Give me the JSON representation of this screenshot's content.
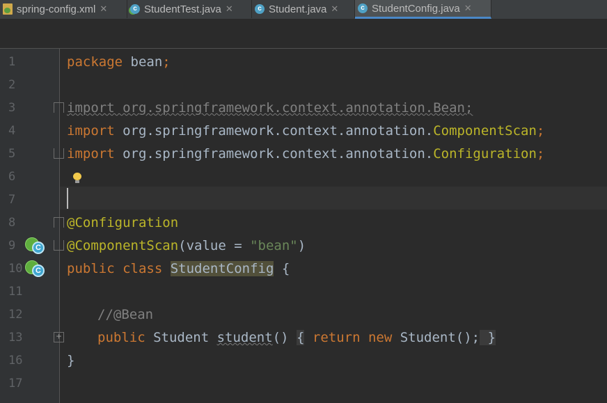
{
  "tabs": [
    {
      "label": "spring-config.xml",
      "icon": "spring-xml-file-icon",
      "active": false
    },
    {
      "label": "StudentTest.java",
      "icon": "runnable-class-icon",
      "active": false
    },
    {
      "label": "Student.java",
      "icon": "class-icon",
      "active": false
    },
    {
      "label": "StudentConfig.java",
      "icon": "class-icon",
      "active": true
    }
  ],
  "close_glyph": "✕",
  "line_numbers": [
    "1",
    "2",
    "3",
    "4",
    "5",
    "6",
    "7",
    "8",
    "9",
    "10",
    "11",
    "12",
    "13",
    "16",
    "17"
  ],
  "code": {
    "l1_kw": "package",
    "l1_rest": " bean",
    "l1_semi": ";",
    "l3_text": "import org.springframework.context.annotation.Bean;",
    "l4_kw": "import",
    "l4_pkg": " org.springframework.context.annotation.",
    "l4_cls": "ComponentScan",
    "l4_semi": ";",
    "l5_kw": "import",
    "l5_pkg": " org.springframework.context.annotation.",
    "l5_cls": "Configuration",
    "l5_semi": ";",
    "l8_ann": "@Configuration",
    "l9_ann": "@ComponentScan",
    "l9_open": "(value = ",
    "l9_str": "\"bean\"",
    "l9_close": ")",
    "l10_kw": "public class ",
    "l10_name": "StudentConfig",
    "l10_brace": " {",
    "l12_comment": "//@Bean",
    "l13_kw": "public ",
    "l13_type": "Student ",
    "l13_method": "student",
    "l13_parens": "() ",
    "l13_lbrace": "{",
    "l13_return": " return new ",
    "l13_ctor": "Student();",
    "l13_rbrace": " }",
    "l16_brace": "}"
  },
  "colors": {
    "background": "#2b2b2b",
    "gutter": "#313335",
    "keyword": "#cc7832",
    "annotation": "#bbb529",
    "string": "#6a8759",
    "comment": "#808080",
    "text": "#a9b7c6",
    "active_tab_underline": "#4a88c7"
  }
}
